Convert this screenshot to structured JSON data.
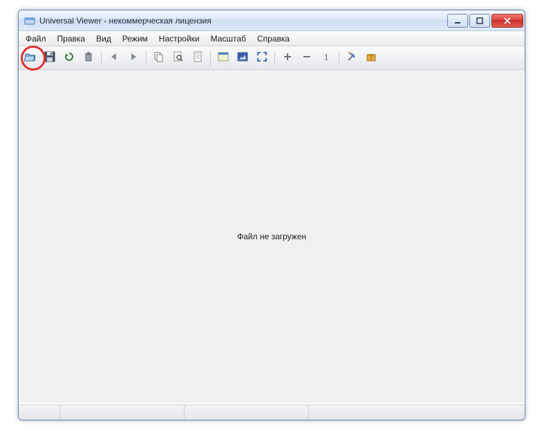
{
  "window": {
    "title": "Universal Viewer - некоммерческая лицензия"
  },
  "menu": {
    "items": [
      "Файл",
      "Правка",
      "Вид",
      "Режим",
      "Настройки",
      "Масштаб",
      "Справка"
    ]
  },
  "toolbar": {
    "open": "Открыть",
    "save": "Сохранить",
    "reload": "Перезагрузить",
    "delete": "Удалить",
    "back": "Назад",
    "forward": "Вперёд",
    "copy": "Копировать",
    "find": "Найти",
    "page": "Страница",
    "fit_window": "По окну",
    "fit_image": "Изображение",
    "fullscreen": "Во весь экран",
    "zoom_in": "Увеличить",
    "zoom_out": "Уменьшить",
    "zoom_100": "100%",
    "options": "Настройки",
    "plugins": "Плагины"
  },
  "content": {
    "empty_message": "Файл не загружен"
  }
}
